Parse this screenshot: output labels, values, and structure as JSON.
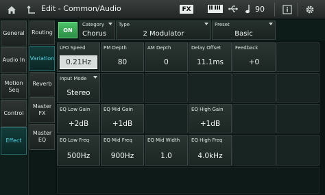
{
  "topbar": {
    "title": "Edit - Common/Audio",
    "fx_badge": "FX",
    "tempo": "90",
    "icons": [
      "home-icon",
      "back-arrow-icon",
      "keyboard-icon",
      "usb-icon",
      "note-icon",
      "info-icon",
      "gear-icon"
    ]
  },
  "nav_primary": [
    {
      "label": "General",
      "active": false
    },
    {
      "label": "Audio In",
      "active": false
    },
    {
      "label": "Motion Seq",
      "active": false
    },
    {
      "label": "Control",
      "active": false
    },
    {
      "label": "Effect",
      "active": true
    }
  ],
  "nav_secondary": [
    {
      "label": "Routing",
      "active": false
    },
    {
      "label": "Variation",
      "active": true
    },
    {
      "label": "Reverb",
      "active": false
    },
    {
      "label": "Master FX",
      "active": false
    },
    {
      "label": "Master EQ",
      "active": false
    }
  ],
  "header": {
    "on_label": "ON",
    "category_label": "Category",
    "category_value": "Chorus",
    "type_label": "Type",
    "type_value": "2 Modulator",
    "preset_label": "Preset",
    "preset_value": "Basic"
  },
  "params": {
    "lfo_speed": {
      "label": "LFO Speed",
      "value": "0.21Hz"
    },
    "pm_depth": {
      "label": "PM Depth",
      "value": "80"
    },
    "am_depth": {
      "label": "AM Depth",
      "value": "0"
    },
    "delay_offset": {
      "label": "Delay Offset",
      "value": "11.1ms"
    },
    "feedback": {
      "label": "Feedback",
      "value": "+0"
    },
    "input_mode": {
      "label": "Input Mode",
      "value": "Stereo"
    },
    "eq_low_gain": {
      "label": "EQ Low Gain",
      "value": "+2dB"
    },
    "eq_mid_gain": {
      "label": "EQ Mid Gain",
      "value": "+1dB"
    },
    "eq_high_gain": {
      "label": "EQ High Gain",
      "value": "+1dB"
    },
    "eq_low_freq": {
      "label": "EQ Low Freq",
      "value": "500Hz"
    },
    "eq_mid_freq": {
      "label": "EQ Mid Freq",
      "value": "900Hz"
    },
    "eq_mid_width": {
      "label": "EQ Mid Width",
      "value": "1.0"
    },
    "eq_high_freq": {
      "label": "EQ High Freq",
      "value": "4.0kHz"
    }
  },
  "colors": {
    "accent": "#4fd7e6",
    "on_green": "#3aab57",
    "background": "#0b1714"
  }
}
